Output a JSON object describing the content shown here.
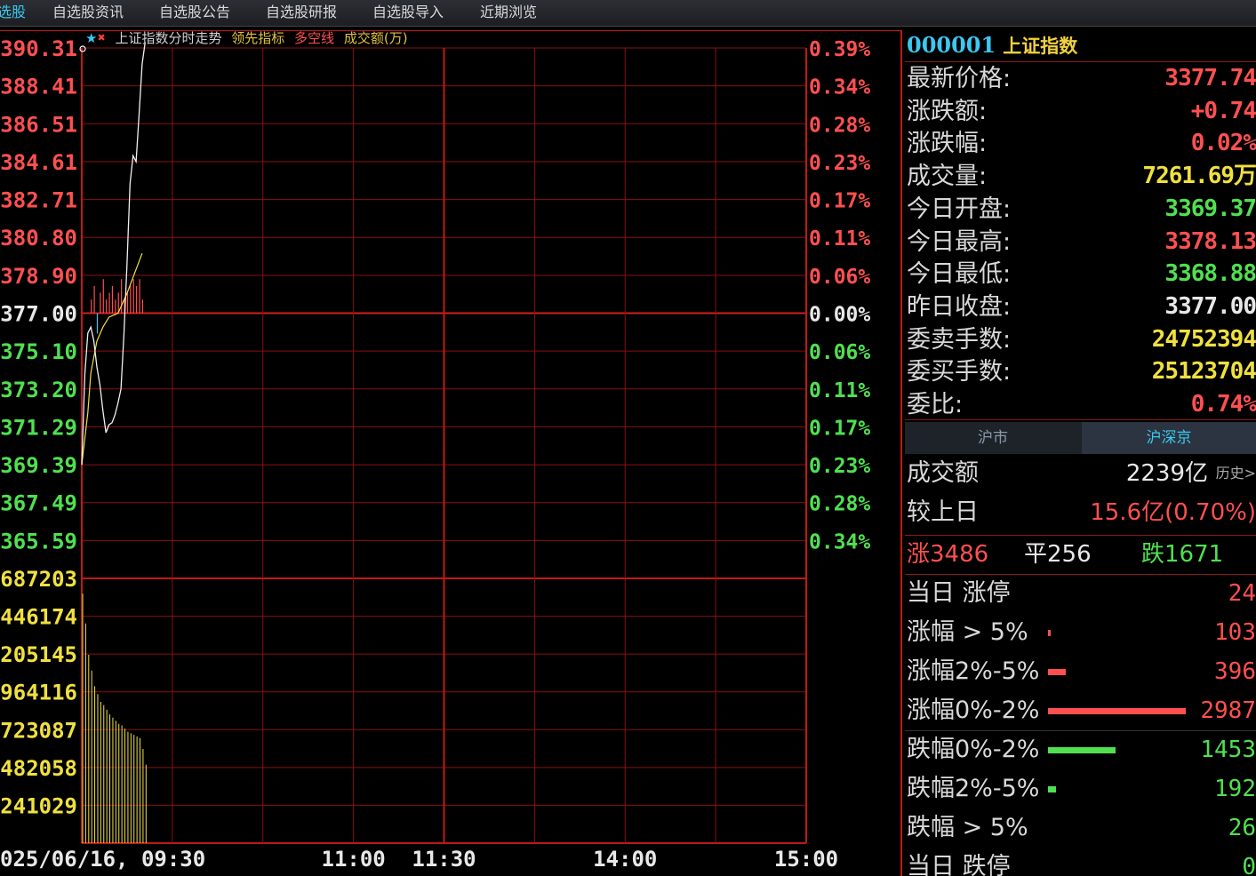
{
  "tabs": [
    {
      "label": "选股",
      "active": true
    },
    {
      "label": "自选股资讯",
      "active": false
    },
    {
      "label": "自选股公告",
      "active": false
    },
    {
      "label": "自选股研报",
      "active": false
    },
    {
      "label": "自选股导入",
      "active": false
    },
    {
      "label": "近期浏览",
      "active": false
    }
  ],
  "chart_header": {
    "icon1": "★",
    "icon2": "✖",
    "title": "上证指数分时走势",
    "ind1": "领先指标",
    "ind2": "多空线",
    "ind3": "成交额(万)"
  },
  "chart_data": {
    "type": "line",
    "price_ticks": [
      "390.31",
      "388.41",
      "386.51",
      "384.61",
      "382.71",
      "380.80",
      "378.90",
      "377.00",
      "375.10",
      "373.20",
      "371.29",
      "369.39",
      "367.49",
      "365.59"
    ],
    "pct_ticks": [
      "0.39%",
      "0.34%",
      "0.28%",
      "0.23%",
      "0.17%",
      "0.11%",
      "0.06%",
      "0.00%",
      "0.06%",
      "0.11%",
      "0.17%",
      "0.23%",
      "0.28%",
      "0.34%"
    ],
    "volume_ticks": [
      "687203",
      "446174",
      "205145",
      "964116",
      "723087",
      "482058",
      "241029"
    ],
    "time_labels": [
      {
        "label": "025/06/16, 09:30",
        "minute": 0
      },
      {
        "label": "11:00",
        "minute": 90
      },
      {
        "label": "11:30",
        "minute": 120
      },
      {
        "label": "14:00",
        "minute": 180
      },
      {
        "label": "15:00",
        "minute": 240
      }
    ],
    "ylim": [
      3365.59,
      3390.31
    ],
    "prev_close": 3377.0,
    "price_line": [
      [
        0,
        3369.39
      ],
      [
        1,
        3373.9
      ],
      [
        2,
        3376.0
      ],
      [
        3,
        3376.3
      ],
      [
        4,
        3375.6
      ],
      [
        5,
        3374.3
      ],
      [
        6,
        3373.4
      ],
      [
        7,
        3372.1
      ],
      [
        8,
        3371.0
      ],
      [
        9,
        3371.4
      ],
      [
        10,
        3371.5
      ],
      [
        11,
        3371.9
      ],
      [
        12,
        3372.5
      ],
      [
        13,
        3373.2
      ],
      [
        14,
        3376.0
      ],
      [
        15,
        3379.5
      ],
      [
        16,
        3383.5
      ],
      [
        17,
        3384.9
      ],
      [
        18,
        3384.6
      ],
      [
        19,
        3387.0
      ],
      [
        20,
        3389.5
      ],
      [
        21,
        3390.6
      ]
    ],
    "avg_line": [
      [
        0,
        3369.39
      ],
      [
        2,
        3372.0
      ],
      [
        3,
        3374.0
      ],
      [
        5,
        3375.6
      ],
      [
        7,
        3376.3
      ],
      [
        9,
        3376.8
      ],
      [
        12,
        3377.0
      ],
      [
        15,
        3378.0
      ],
      [
        20,
        3380.0
      ]
    ],
    "leading_bars": [
      {
        "minute": 3,
        "pct": 0.02,
        "dir": "up"
      },
      {
        "minute": 4,
        "pct": 0.04,
        "dir": "up"
      },
      {
        "minute": 5,
        "pct": -0.03,
        "dir": "down"
      },
      {
        "minute": 6,
        "pct": 0.03,
        "dir": "up"
      },
      {
        "minute": 7,
        "pct": 0.05,
        "dir": "up"
      },
      {
        "minute": 8,
        "pct": 0.02,
        "dir": "up"
      },
      {
        "minute": 9,
        "pct": 0.03,
        "dir": "up"
      },
      {
        "minute": 10,
        "pct": 0.04,
        "dir": "up"
      },
      {
        "minute": 11,
        "pct": 0.02,
        "dir": "up"
      },
      {
        "minute": 12,
        "pct": 0.03,
        "dir": "up"
      },
      {
        "minute": 13,
        "pct": 0.05,
        "dir": "up"
      },
      {
        "minute": 14,
        "pct": 0.02,
        "dir": "up"
      },
      {
        "minute": 15,
        "pct": 0.03,
        "dir": "up"
      },
      {
        "minute": 16,
        "pct": 0.04,
        "dir": "up"
      },
      {
        "minute": 17,
        "pct": 0.05,
        "dir": "up"
      },
      {
        "minute": 18,
        "pct": 0.04,
        "dir": "up"
      },
      {
        "minute": 19,
        "pct": 0.05,
        "dir": "up"
      },
      {
        "minute": 20,
        "pct": 0.02,
        "dir": "up"
      }
    ],
    "volume_bars": [
      1590000,
      1400000,
      1200000,
      1100000,
      1000000,
      950000,
      900000,
      880000,
      850000,
      820000,
      800000,
      780000,
      760000,
      750000,
      730000,
      710000,
      700000,
      690000,
      680000,
      670000,
      600000,
      500000
    ],
    "volume_max": 1687203
  },
  "info": {
    "code": "000001",
    "name": "上证指数",
    "quotes": [
      {
        "label": "最新价格:",
        "value": "3377.74",
        "color": "#ff5050"
      },
      {
        "label": "涨跌额:",
        "value": "+0.74",
        "color": "#ff5050"
      },
      {
        "label": "涨跌幅:",
        "value": "0.02%",
        "color": "#ff5050"
      },
      {
        "label": "成交量:",
        "value": "7261.69万",
        "color": "#f0e040"
      },
      {
        "label": "今日开盘:",
        "value": "3369.37",
        "color": "#50e050"
      },
      {
        "label": "今日最高:",
        "value": "3378.13",
        "color": "#ff5050"
      },
      {
        "label": "今日最低:",
        "value": "3368.88",
        "color": "#50e050"
      },
      {
        "label": "昨日收盘:",
        "value": "3377.00",
        "color": "#e8e8e8"
      },
      {
        "label": "委卖手数:",
        "value": "24752394",
        "color": "#f0e040"
      },
      {
        "label": "委买手数:",
        "value": "25123704",
        "color": "#f0e040"
      },
      {
        "label": "委比:",
        "value": "0.74%",
        "color": "#ff5050"
      }
    ],
    "market_tabs": {
      "sh": "沪市",
      "hs": "沪深京"
    },
    "turnover_label": "成交额",
    "turnover_value": "2239亿",
    "history_label": "历史>",
    "vs_prev_label": "较上日",
    "vs_prev_value": "15.6亿(0.70%)",
    "up_label": "涨3486",
    "flat_label": "平256",
    "down_label": "跌1671",
    "breadth": [
      {
        "label": "当日 涨停",
        "value": "24",
        "color": "#ff5050",
        "bar": 0
      },
      {
        "label": "涨幅 > 5%",
        "value": "103",
        "color": "#ff5050",
        "bar": 0.02
      },
      {
        "label": "涨幅2%-5%",
        "value": "396",
        "color": "#ff5050",
        "bar": 0.13
      },
      {
        "label": "涨幅0%-2%",
        "value": "2987",
        "color": "#ff5050",
        "bar": 1.0
      },
      {
        "label": "跌幅0%-2%",
        "value": "1453",
        "color": "#50e050",
        "bar": 0.49
      },
      {
        "label": "跌幅2%-5%",
        "value": "192",
        "color": "#50e050",
        "bar": 0.06
      },
      {
        "label": "跌幅 > 5%",
        "value": "26",
        "color": "#50e050",
        "bar": 0
      },
      {
        "label": "当日 跌停",
        "value": "0",
        "color": "#50e050",
        "bar": 0
      }
    ]
  }
}
